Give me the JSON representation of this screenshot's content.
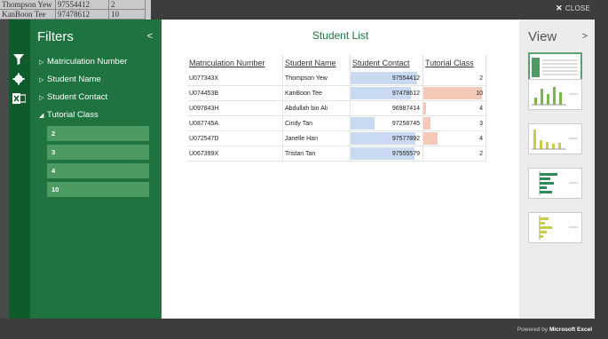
{
  "background_sheet": {
    "rows": [
      [
        "Thompson Yew",
        "97554412",
        "2"
      ],
      [
        "KanBoon Tee",
        "97478612",
        "10"
      ]
    ]
  },
  "topbar": {
    "close_label": "CLOSE"
  },
  "filters": {
    "title": "Filters",
    "fields": [
      "Matriculation Number",
      "Student Name",
      "Student Contact",
      "Tutorial Class"
    ],
    "tutorial_values": [
      "2",
      "3",
      "4",
      "10"
    ]
  },
  "main": {
    "title": "Student List",
    "columns": [
      "Matriculation Number",
      "Student Name",
      "Student Contact",
      "Tutorial Class"
    ],
    "rows": [
      {
        "matric": "U077343X",
        "name": "Thompson Yew",
        "contact": "97554412",
        "class": "2"
      },
      {
        "matric": "U074453B",
        "name": "KanBoon Tee",
        "contact": "97478612",
        "class": "10"
      },
      {
        "matric": "U097843H",
        "name": "Abdullah bin Ali",
        "contact": "96987414",
        "class": "4"
      },
      {
        "matric": "U087745A",
        "name": "Cindy Tan",
        "contact": "97258745",
        "class": "3"
      },
      {
        "matric": "U072547D",
        "name": "Janelle Han",
        "contact": "97577892",
        "class": "4"
      },
      {
        "matric": "U067399X",
        "name": "Tristan Tan",
        "contact": "97555579",
        "class": "2"
      }
    ],
    "contact_bar_fraction": [
      0.97,
      0.88,
      0.0,
      0.35,
      0.95,
      0.94
    ],
    "class_bar_fraction": [
      0.0,
      1.0,
      0.05,
      0.12,
      0.24,
      0.0
    ]
  },
  "view": {
    "title": "View"
  },
  "footer": {
    "prefix": "Powered by",
    "brand": "Microsoft Excel"
  },
  "colors": {
    "accent": "#1f7340",
    "panel": "#1f7340",
    "filter_value": "#4d9a63",
    "contact_bar": "#c9d9f1",
    "class_bar": "#f5c9b7"
  }
}
